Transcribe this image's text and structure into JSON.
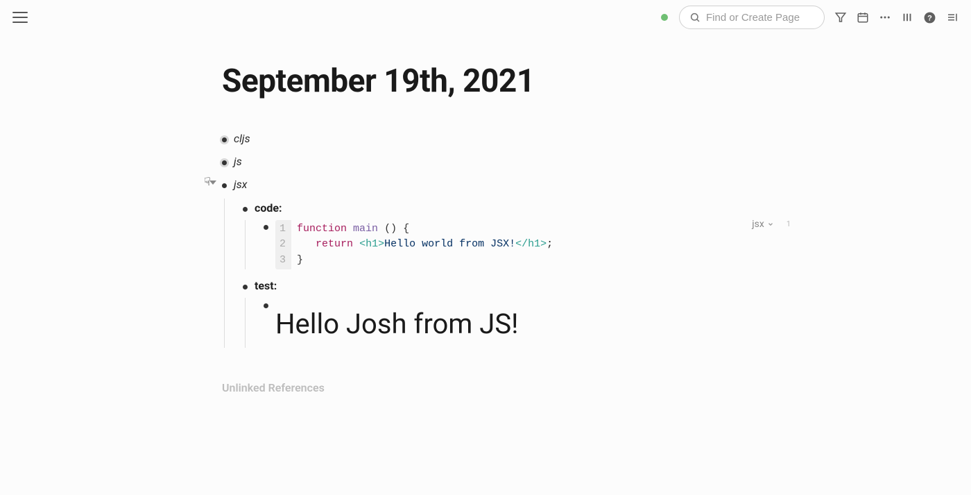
{
  "search": {
    "placeholder": "Find or Create Page"
  },
  "page": {
    "title": "September 19th, 2021"
  },
  "blocks": {
    "cljs": "cljs",
    "js": "js",
    "jsx": "jsx",
    "code_label": "code:",
    "test_label": "test:",
    "result_text": "Hello Josh from JS!"
  },
  "code": {
    "lang_label": "jsx",
    "line_count_badge": "1",
    "lines": {
      "n1": "1",
      "n2": "2",
      "n3": "3",
      "l1_kw": "function",
      "l1_fn": "main",
      "l1_rest": "() {",
      "l2_kw": "return",
      "l2_open": "<h1>",
      "l2_text": "Hello world from JSX!",
      "l2_close": "</h1>",
      "l2_semi": ";",
      "l3": "}"
    }
  },
  "footer": {
    "unlinked": "Unlinked References"
  }
}
